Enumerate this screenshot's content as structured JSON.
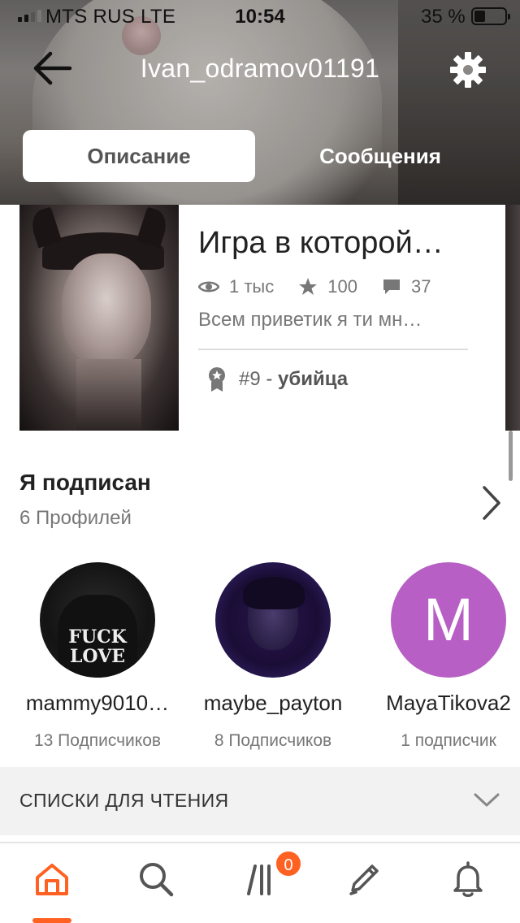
{
  "status_bar": {
    "carrier": "MTS RUS  LTE",
    "time": "10:54",
    "battery": "35 %",
    "battery_level_pct": 35
  },
  "nav": {
    "username": "Ivan_odramov01191",
    "back_icon": "arrow-left-icon",
    "settings_icon": "gear-icon"
  },
  "tabs": [
    {
      "label": "Описание",
      "active": true
    },
    {
      "label": "Сообщения",
      "active": false
    }
  ],
  "story": {
    "title": "Игра в которой…",
    "views": "1 тыс",
    "votes": "100",
    "comments": "37",
    "description": "Всем приветик я ти мн…",
    "rank_number": "#9",
    "rank_separator": " - ",
    "rank_title": "убийца"
  },
  "following": {
    "title": "Я подписан",
    "count": "6 Профилей",
    "profiles": [
      {
        "name": "mammy9010…",
        "followers": "13 Подписчиков",
        "avatar_print": "FUCK LOVE"
      },
      {
        "name": "maybe_payton",
        "followers": "8 Подписчиков"
      },
      {
        "name": "MayaTikova2",
        "followers": "1 подписчик",
        "avatar_letter": "M",
        "avatar_color": "#b75fc4"
      }
    ]
  },
  "reading_lists": {
    "label": "СПИСКИ ДЛЯ ЧТЕНИЯ"
  },
  "tabbar": {
    "accent_color": "#ff6122",
    "items": [
      "home-icon",
      "search-icon",
      "library-icon",
      "pencil-icon",
      "bell-icon"
    ],
    "library_badge": "0"
  }
}
